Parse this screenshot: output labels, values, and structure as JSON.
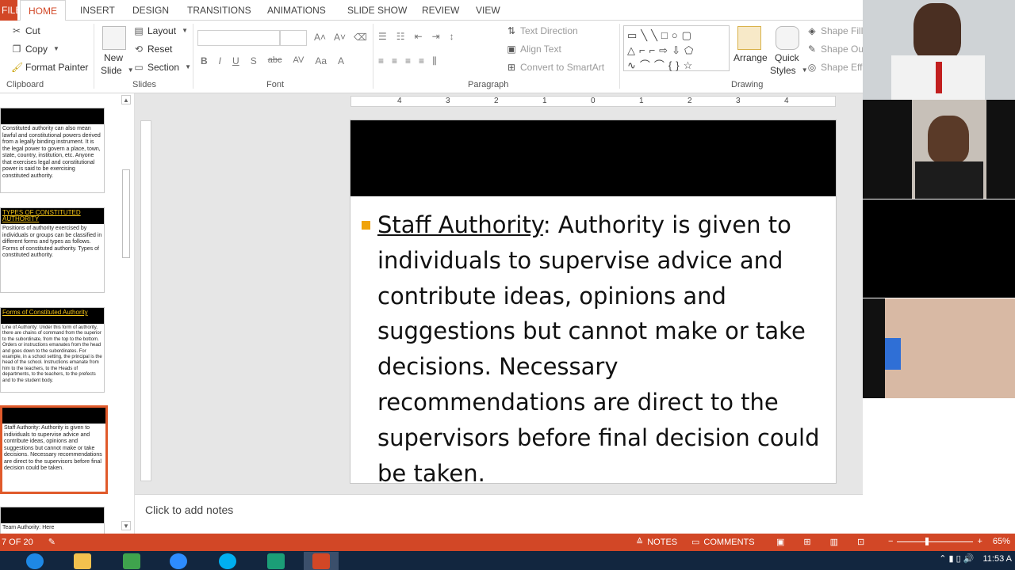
{
  "ribbon_tabs": [
    "FILE",
    "HOME",
    "INSERT",
    "DESIGN",
    "TRANSITIONS",
    "ANIMATIONS",
    "SLIDE SHOW",
    "REVIEW",
    "VIEW"
  ],
  "clipboard": {
    "cut": "Cut",
    "copy": "Copy",
    "format_painter": "Format Painter",
    "label": "Clipboard"
  },
  "slides_group": {
    "new_slide": "New",
    "new_slide2": "Slide",
    "layout": "Layout",
    "reset": "Reset",
    "section": "Section",
    "label": "Slides"
  },
  "font_group": {
    "label": "Font",
    "bold": "B",
    "italic": "I",
    "underline": "U",
    "strike": "abc",
    "spacing": "AV",
    "case": "Aa",
    "color": "A"
  },
  "paragraph_group": {
    "text_direction": "Text Direction",
    "align_text": "Align Text",
    "convert_smartart": "Convert to SmartArt",
    "label": "Paragraph"
  },
  "drawing_group": {
    "arrange": "Arrange",
    "quick_styles": "Quick",
    "quick_styles2": "Styles",
    "shape_fill": "Shape Fill",
    "shape_outline": "Shape Out",
    "shape_effects": "Shape Effe",
    "label": "Drawing"
  },
  "thumbnails": [
    {
      "title": "",
      "text": "Constituted authority can also mean lawful and constitutional powers derived from a legally binding instrument. It is the legal power to govern a place, town, state, country, institution, etc. Anyone that exercises legal and constitutional power is said to be exercising constituted authority."
    },
    {
      "title": "TYPES OF CONSTITUTED AUTHORITY",
      "text": "Positions of authority exercised by individuals or groups can be classified in different forms and types as follows. Forms of constituted authority. Types of constituted authority."
    },
    {
      "title": "Forms of Constituted Authority",
      "text": "Line of Authority: Under this form of authority, there are chains of command from the superior to the subordinate, from the top to the bottom. Orders or instructions emanates from the head and goes down to the subordinates. For example, in a school setting, the principal is the head of the school. Instructions emanate from him to the teachers, to the Heads of departments, to the teachers, to the prefects and to the student body."
    },
    {
      "title": "",
      "text": "Staff Authority: Authority is given to individuals to supervise advice and contribute ideas, opinions and suggestions but cannot make or take decisions. Necessary recommendations are direct to the supervisors before final decision could be taken."
    },
    {
      "title": "",
      "text": "Team Authority: Here"
    }
  ],
  "slide": {
    "term": "Staff Authority",
    "body": ": Authority is given to individuals to supervise advice and contribute ideas, opinions and suggestions but cannot make or take decisions. Necessary recommendations are direct to the supervisors before final decision could be taken."
  },
  "ruler_labels": [
    "4",
    "3",
    "2",
    "1",
    "0",
    "1",
    "2",
    "3",
    "4"
  ],
  "notes_placeholder": "Click to add notes",
  "status": {
    "slide_counter": "7 OF 20",
    "notes": "NOTES",
    "comments": "COMMENTS",
    "zoom": "65%"
  },
  "clock": "11:53 A",
  "colors": {
    "accent": "#d24726",
    "bullet": "#f0a30a",
    "selected_thumb": "#e05a2b",
    "taskbar": "#12263f"
  }
}
